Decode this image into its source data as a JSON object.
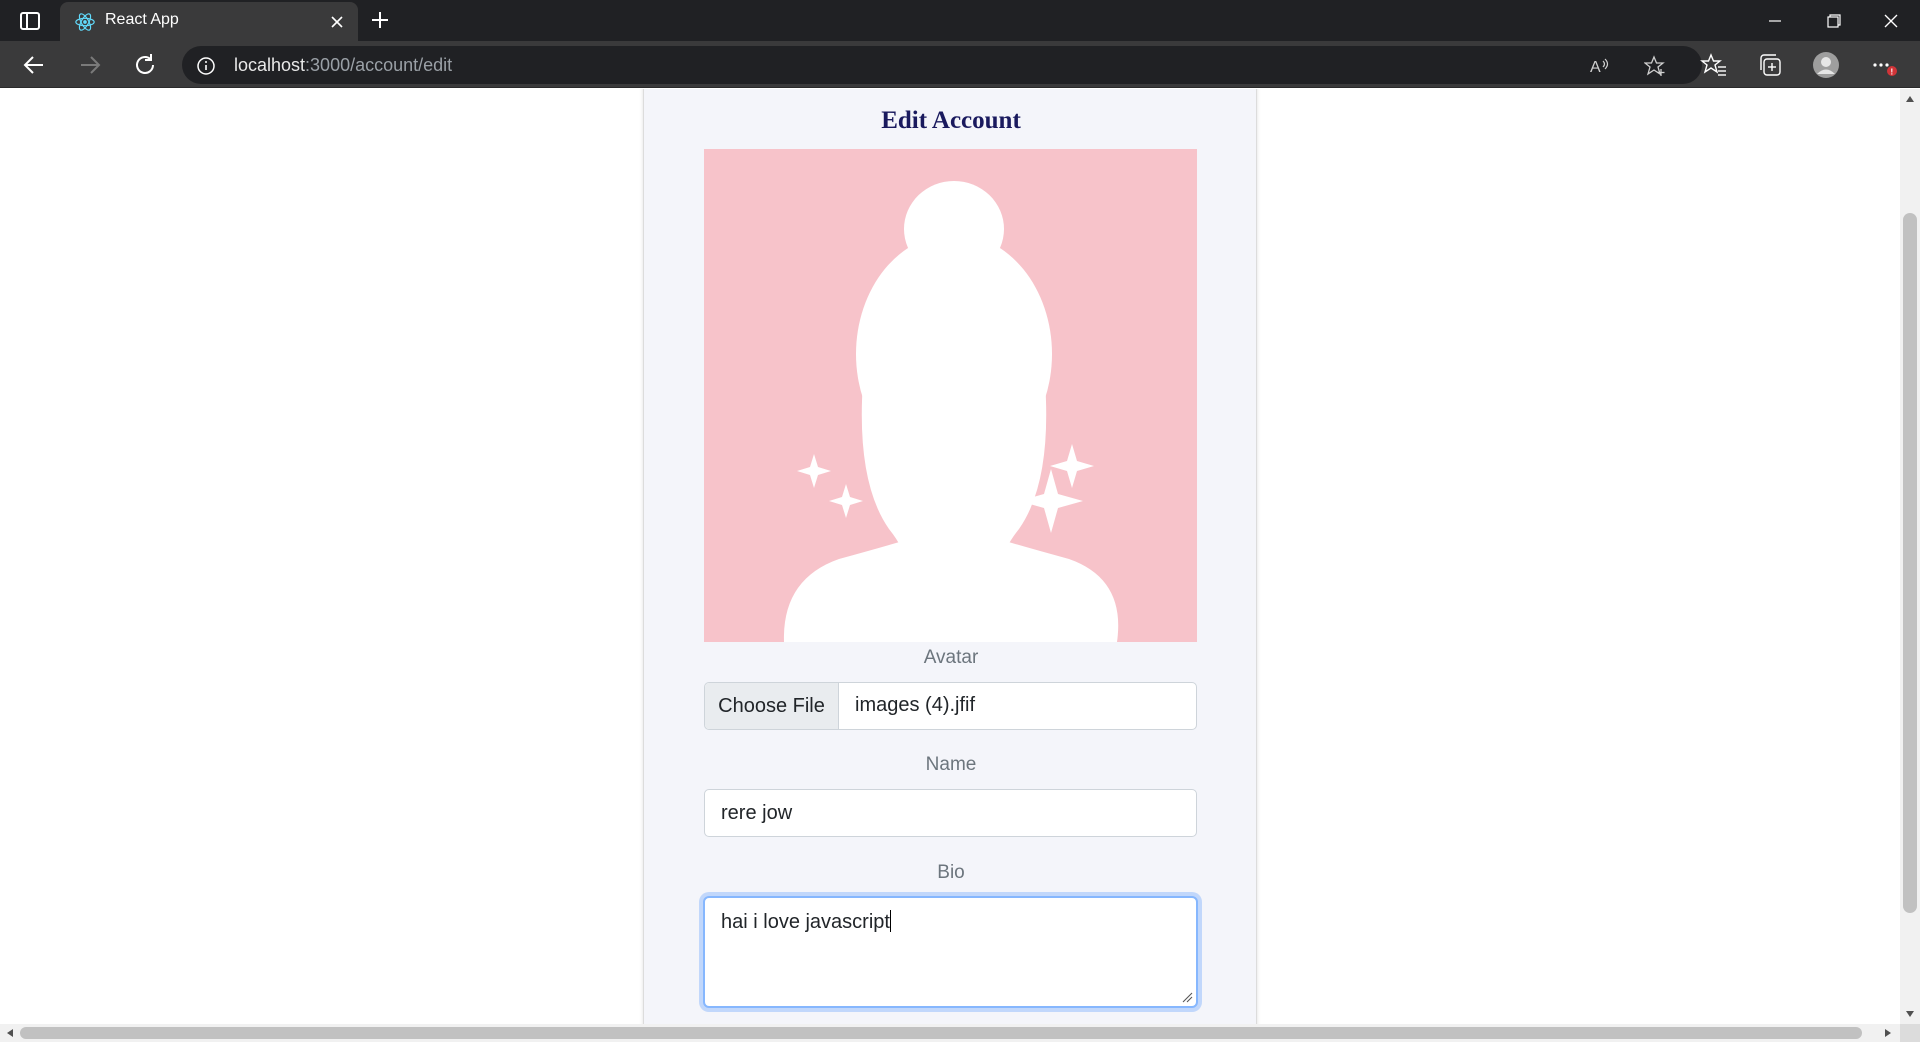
{
  "browser": {
    "tab_title": "React App",
    "url_host": "localhost",
    "url_rest": ":3000/account/edit",
    "icons": [
      "tab-actions-icon",
      "react-favicon",
      "close-icon",
      "plus-icon",
      "minimize-icon",
      "maximize-icon",
      "close-icon",
      "back-icon",
      "forward-icon",
      "reload-icon",
      "info-icon",
      "read-aloud-icon",
      "add-favorite-icon",
      "favorites-icon",
      "collections-icon",
      "profile-icon",
      "more-icon"
    ]
  },
  "page": {
    "title": "Edit Account",
    "avatar_label": "Avatar",
    "file_button": "Choose File",
    "file_name": "images (4).jfif",
    "name_label": "Name",
    "name_value": "rere jow",
    "bio_label": "Bio",
    "bio_value": "hai i love javascript"
  },
  "colors": {
    "avatar_background": "#f7c3ca",
    "title_color": "#1a1a5e",
    "focus_ring": "#86b7fe",
    "card_background": "#f4f5fa"
  }
}
